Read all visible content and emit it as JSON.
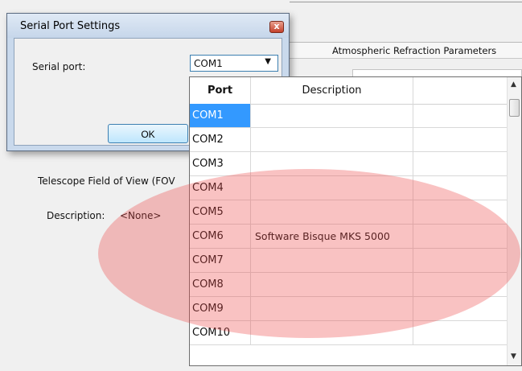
{
  "background": {
    "tab_label": "Atmospheric Refraction Parameters",
    "fov_label": "Telescope Field of View (FOV",
    "description_label": "Description:",
    "description_value": "<None>"
  },
  "dialog": {
    "title": "Serial Port Settings",
    "close_glyph": "x",
    "serial_port_label": "Serial port:",
    "combo_value": "COM1",
    "combo_arrow": "▼",
    "ok_label": "OK"
  },
  "dropdown": {
    "headers": {
      "port": "Port",
      "description": "Description"
    },
    "rows": [
      {
        "port": "COM1",
        "description": ""
      },
      {
        "port": "COM2",
        "description": ""
      },
      {
        "port": "COM3",
        "description": ""
      },
      {
        "port": "COM4",
        "description": ""
      },
      {
        "port": "COM5",
        "description": ""
      },
      {
        "port": "COM6",
        "description": "Software Bisque MKS 5000"
      },
      {
        "port": "COM7",
        "description": ""
      },
      {
        "port": "COM8",
        "description": ""
      },
      {
        "port": "COM9",
        "description": ""
      },
      {
        "port": "COM10",
        "description": ""
      }
    ],
    "selected_port": "COM1",
    "scroll_up_glyph": "▲",
    "scroll_down_glyph": "▼"
  },
  "colors": {
    "selection": "#3399ff",
    "highlight": "#ec4646"
  }
}
